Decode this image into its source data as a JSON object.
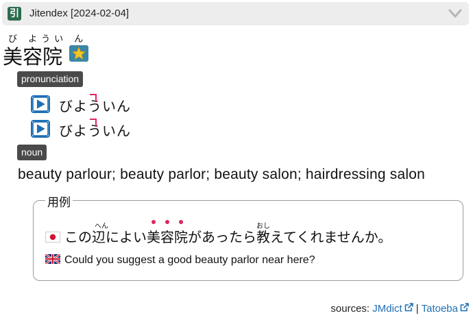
{
  "app": {
    "title": "Jitendex [2024-02-04]",
    "logo_glyph": "引"
  },
  "entry": {
    "reading": "び ようい ん",
    "headword": "美容院",
    "badge_icon": "star-icon"
  },
  "pronunciation": {
    "tag": "pronunciation",
    "items": [
      {
        "text": "びよういん"
      },
      {
        "text": "びよういん"
      }
    ]
  },
  "sense": {
    "pos_tag": "noun",
    "gloss": "beauty parlour; beauty parlor; beauty salon; hairdressing salon"
  },
  "example": {
    "label": "用例",
    "jp_part1": "この",
    "jp_kanji1": "辺",
    "jp_kanji1_furigana": "へん",
    "jp_part2": "によい",
    "jp_highlight": "美容院",
    "jp_part3": "があったら",
    "jp_kanji2": "教",
    "jp_kanji2_furigana": "おし",
    "jp_part4": "えてくれませんか。",
    "en": "Could you suggest a good beauty parlor near here?"
  },
  "sources": {
    "prefix": "sources:",
    "links": [
      "JMdict",
      "Tatoeba"
    ],
    "separator": "|"
  },
  "colors": {
    "accent_blue": "#1e6fb5",
    "pitch_red": "#e0265a",
    "tag_bg": "#4a4a4a",
    "logo_green": "#2c6b4d"
  }
}
